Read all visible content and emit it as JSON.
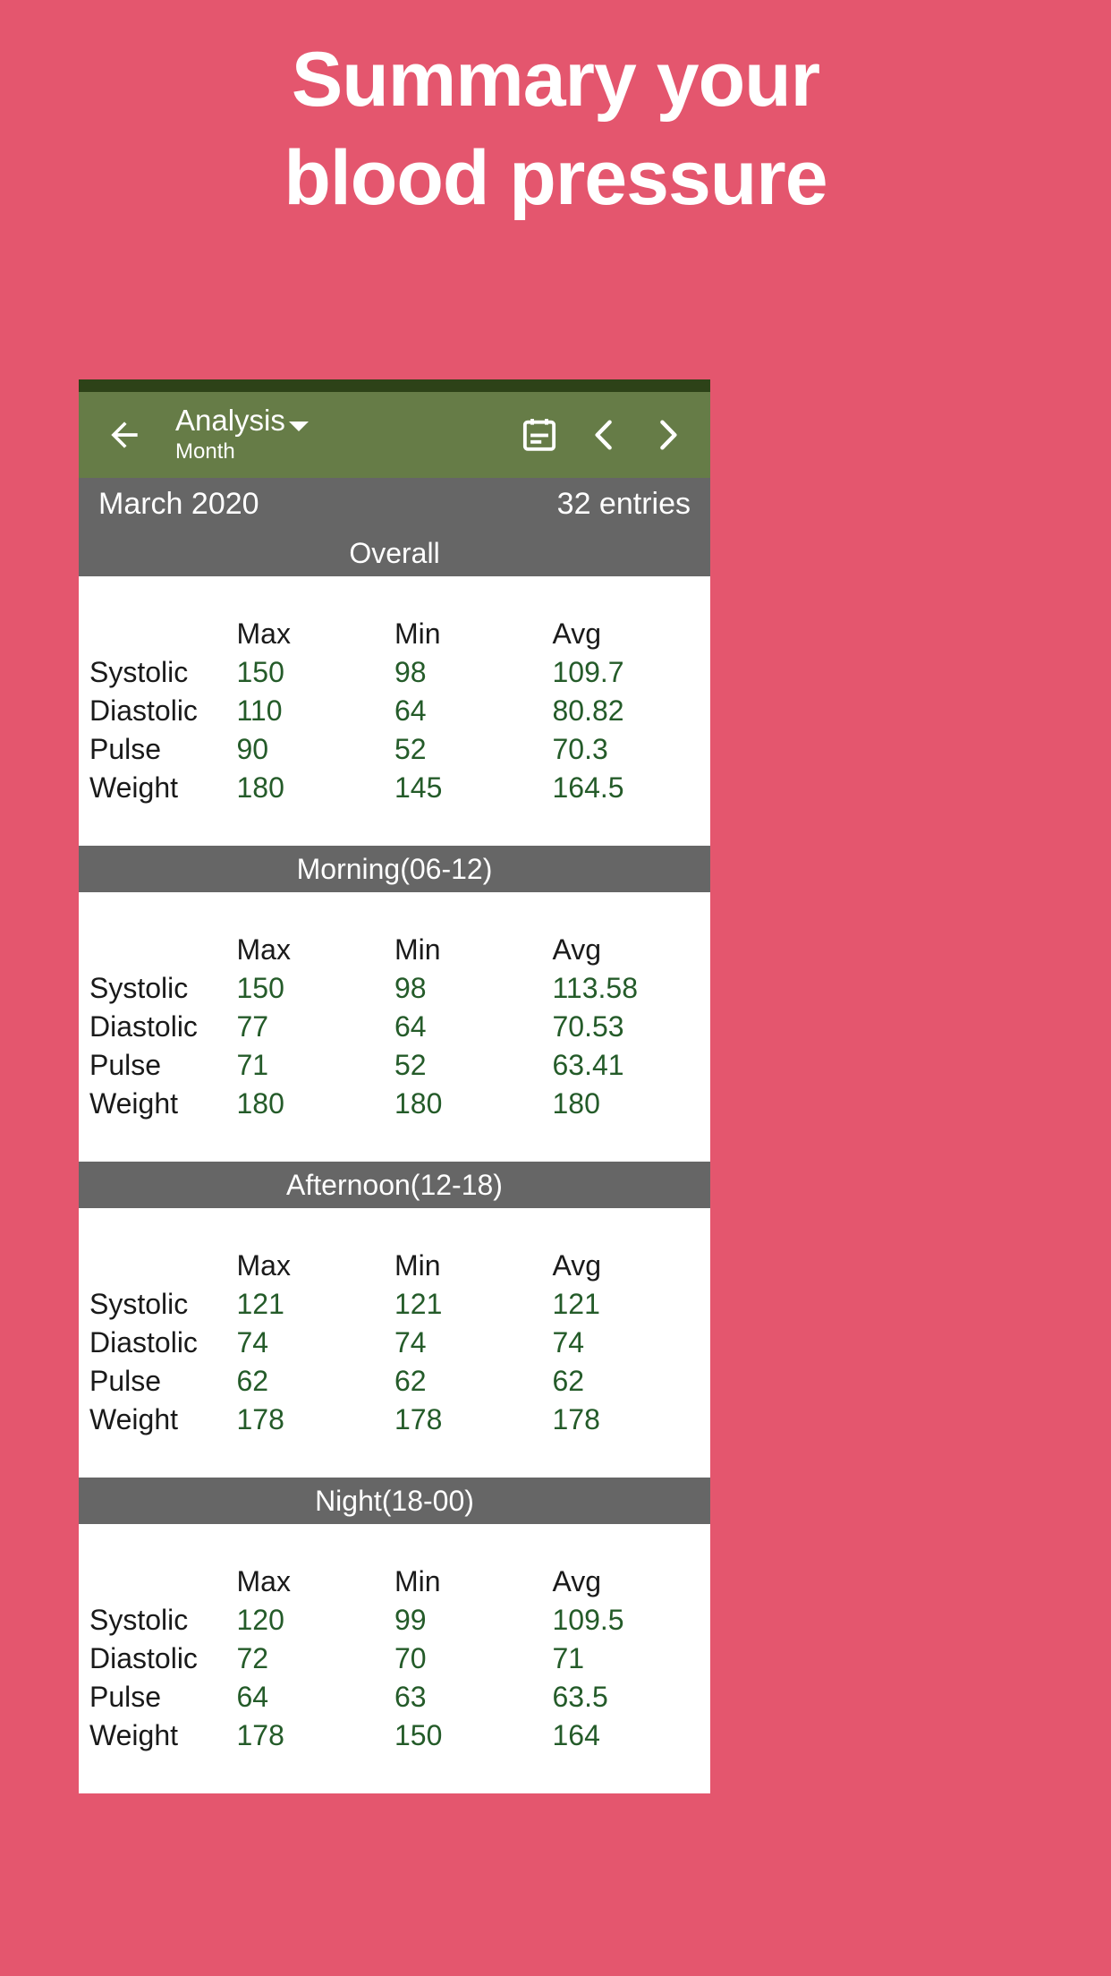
{
  "promo": {
    "line1": "Summary your",
    "line2": "blood pressure"
  },
  "colors": {
    "background": "#e4566e",
    "appbar": "#667c47",
    "statusbar": "#2d4218",
    "section_header": "#666666",
    "value_green": "#245b29"
  },
  "appbar": {
    "back_icon": "arrow-left-icon",
    "title": "Analysis",
    "subtitle": "Month",
    "dropdown_icon": "caret-down-icon",
    "calendar_icon": "calendar-icon",
    "prev_icon": "chevron-left-icon",
    "next_icon": "chevron-right-icon"
  },
  "period_bar": {
    "month": "March 2020",
    "entries": "32 entries"
  },
  "columns": [
    "",
    "Max",
    "Min",
    "Avg"
  ],
  "sections": [
    {
      "title": "Overall",
      "rows": [
        {
          "label": "Systolic",
          "max": "150",
          "min": "98",
          "avg": "109.7"
        },
        {
          "label": "Diastolic",
          "max": "110",
          "min": "64",
          "avg": "80.82"
        },
        {
          "label": "Pulse",
          "max": "90",
          "min": "52",
          "avg": "70.3"
        },
        {
          "label": "Weight",
          "max": "180",
          "min": "145",
          "avg": "164.5"
        }
      ]
    },
    {
      "title": "Morning(06-12)",
      "rows": [
        {
          "label": "Systolic",
          "max": "150",
          "min": "98",
          "avg": "113.58"
        },
        {
          "label": "Diastolic",
          "max": "77",
          "min": "64",
          "avg": "70.53"
        },
        {
          "label": "Pulse",
          "max": "71",
          "min": "52",
          "avg": "63.41"
        },
        {
          "label": "Weight",
          "max": "180",
          "min": "180",
          "avg": "180"
        }
      ]
    },
    {
      "title": "Afternoon(12-18)",
      "rows": [
        {
          "label": "Systolic",
          "max": "121",
          "min": "121",
          "avg": "121"
        },
        {
          "label": "Diastolic",
          "max": "74",
          "min": "74",
          "avg": "74"
        },
        {
          "label": "Pulse",
          "max": "62",
          "min": "62",
          "avg": "62"
        },
        {
          "label": "Weight",
          "max": "178",
          "min": "178",
          "avg": "178"
        }
      ]
    },
    {
      "title": "Night(18-00)",
      "rows": [
        {
          "label": "Systolic",
          "max": "120",
          "min": "99",
          "avg": "109.5"
        },
        {
          "label": "Diastolic",
          "max": "72",
          "min": "70",
          "avg": "71"
        },
        {
          "label": "Pulse",
          "max": "64",
          "min": "63",
          "avg": "63.5"
        },
        {
          "label": "Weight",
          "max": "178",
          "min": "150",
          "avg": "164"
        }
      ]
    }
  ]
}
